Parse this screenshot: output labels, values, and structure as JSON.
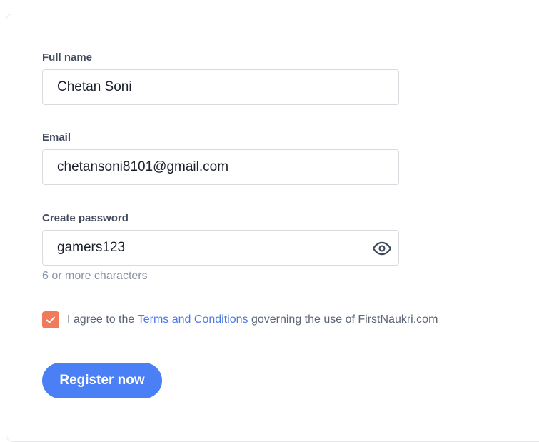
{
  "form": {
    "full_name": {
      "label": "Full name",
      "value": "Chetan Soni"
    },
    "email": {
      "label": "Email",
      "value": "chetansoni8101@gmail.com"
    },
    "password": {
      "label": "Create password",
      "value": "gamers123",
      "hint": "6 or more characters"
    },
    "agree": {
      "checked": true,
      "prefix": "I agree to the",
      "link": "Terms and Conditions",
      "suffix": "governing the use of FirstNaukri.com"
    },
    "register_label": "Register now"
  },
  "colors": {
    "accent": "#4a7ff5",
    "checkbox": "#f27a5b",
    "link": "#4a78e8"
  },
  "icons": [
    "eye-icon",
    "checkmark-icon"
  ]
}
